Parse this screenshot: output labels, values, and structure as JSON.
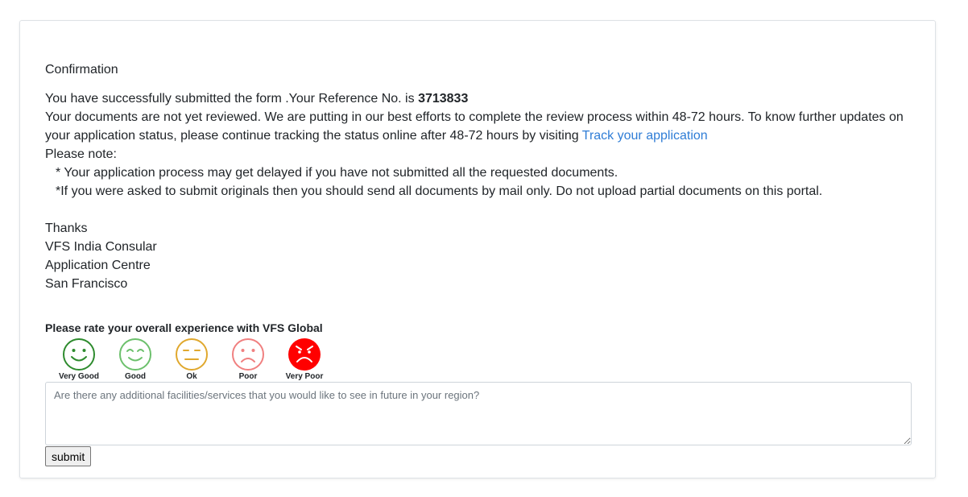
{
  "confirmation": {
    "title": "Confirmation",
    "line1_prefix": "You have successfully submitted the form .Your Reference No. is ",
    "reference_no": "3713833",
    "line2_text": "Your documents are not yet reviewed. We are putting in our best efforts to complete the review process within 48-72 hours. To know further updates on your application status, please continue tracking the status online after 48-72 hours by visiting ",
    "track_link": "Track your application",
    "please_note": "Please note:",
    "notes": [
      "* Your application process may get delayed if you have not submitted all the requested documents.",
      "*If you were asked to submit originals then you should send all documents by mail only. Do not upload partial documents on this portal."
    ],
    "signature": [
      "Thanks",
      "VFS India Consular",
      "Application Centre",
      "San Francisco"
    ]
  },
  "rating": {
    "title": "Please rate your overall experience with VFS Global",
    "options": [
      {
        "label": "Very Good",
        "icon": "very-good-smiley-icon",
        "color": "#2e8b2e"
      },
      {
        "label": "Good",
        "icon": "good-smiley-icon",
        "color": "#6cc06c"
      },
      {
        "label": "Ok",
        "icon": "ok-neutral-face-icon",
        "color": "#e0a82e"
      },
      {
        "label": "Poor",
        "icon": "poor-sad-face-icon",
        "color": "#f08080"
      },
      {
        "label": "Very Poor",
        "icon": "very-poor-angry-face-icon",
        "color": "#ff0000"
      }
    ]
  },
  "feedback": {
    "placeholder": "Are there any additional facilities/services that you would like to see in future in your region?"
  },
  "submit_label": "submit",
  "colors": {
    "link": "#2f7dd6",
    "border": "#dee2e6"
  }
}
